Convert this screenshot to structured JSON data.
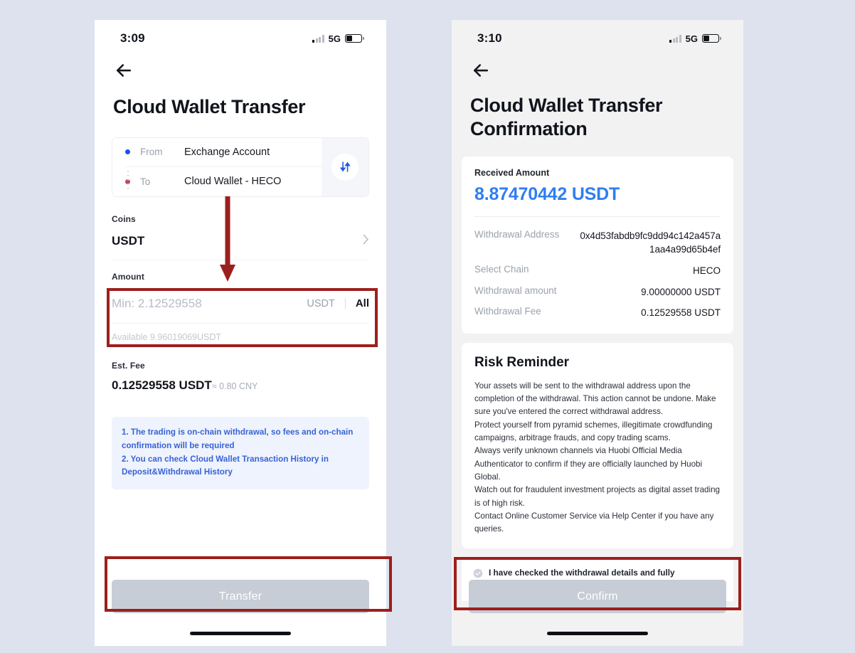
{
  "background_color": "#dde2ee",
  "annotation_color": "#9c1f1c",
  "accent_blue": "#2f7ef2",
  "left_phone": {
    "status": {
      "time": "3:09",
      "network": "5G"
    },
    "back_icon": "back-arrow-icon",
    "title": "Cloud Wallet Transfer",
    "transfer_route": {
      "from_label": "From",
      "from_value": "Exchange Account",
      "to_label": "To",
      "to_value": "Cloud Wallet - HECO",
      "swap_icon": "swap-vertical-icon"
    },
    "coins": {
      "label": "Coins",
      "value": "USDT",
      "chevron": "chevron-right-icon"
    },
    "amount": {
      "label": "Amount",
      "placeholder": "Min: 2.12529558",
      "value": "",
      "unit": "USDT",
      "all_label": "All",
      "available": "Available 9.96019069USDT"
    },
    "est_fee": {
      "label": "Est. Fee",
      "value": "0.12529558 USDT",
      "fiat": "≈ 0.80 CNY"
    },
    "note": "1. The trading is on-chain withdrawal, so fees and on-chain confirmation will be required\n 2. You can check Cloud Wallet Transaction History in Deposit&Withdrawal History",
    "cta_label": "Transfer"
  },
  "right_phone": {
    "status": {
      "time": "3:10",
      "network": "5G"
    },
    "back_icon": "back-arrow-icon",
    "title": "Cloud Wallet Transfer Confirmation",
    "received": {
      "label": "Received Amount",
      "value": "8.87470442 USDT"
    },
    "details": [
      {
        "key": "Withdrawal Address",
        "value": "0x4d53fabdb9fc9dd94c142a457a1aa4a99d65b4ef"
      },
      {
        "key": "Select Chain",
        "value": "HECO"
      },
      {
        "key": "Withdrawal amount",
        "value": "9.00000000 USDT"
      },
      {
        "key": "Withdrawal Fee",
        "value": "0.12529558 USDT"
      }
    ],
    "risk": {
      "title": "Risk Reminder",
      "body": "Your assets will be sent to the withdrawal address upon the completion of the withdrawal. This action cannot be undone. Make sure you've entered the correct withdrawal address.\nProtect yourself from pyramid schemes, illegitimate crowdfunding campaigns, arbitrage frauds, and copy trading scams.\nAlways verify unknown channels via Huobi Official Media Authenticator to confirm if they are officially launched by Huobi Global.\nWatch out for fraudulent investment projects as digital asset trading is of high risk.\nContact Online Customer Service via Help Center if you have any queries."
    },
    "agreement": {
      "checkbox_icon": "check-circle-icon",
      "checked": false,
      "text": "I have checked the withdrawal details and fully understand all the risks."
    },
    "cta_label": "Confirm"
  }
}
